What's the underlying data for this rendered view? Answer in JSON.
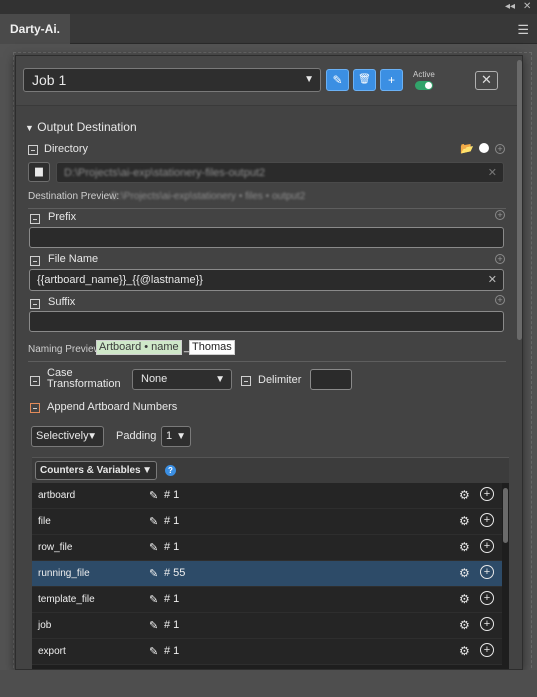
{
  "window": {
    "collapse_glyph": "◂◂",
    "close_glyph": "✕"
  },
  "tab": {
    "title": "Darty-Ai.",
    "menu_glyph": "☰"
  },
  "header": {
    "job_select": "Job 1",
    "active_label": "Active",
    "edit_glyph": "✎",
    "delete_glyph": "🗑",
    "add_glyph": "+",
    "close_glyph": "✕"
  },
  "output": {
    "section_label": "Output Destination",
    "directory_label": "Directory",
    "directory_path": "D:\\Projects\\ai-exp\\stationery-files-output2",
    "destination_preview_label": "Destination Preview:",
    "destination_preview_value": "D:\\Projects\\ai-exp\\stationery • files • output2",
    "prefix_label": "Prefix",
    "prefix_value": "",
    "filename_label": "File Name",
    "filename_value": "{{artboard_name}}_{{@lastname}}",
    "suffix_label": "Suffix",
    "suffix_value": "",
    "naming_preview_label": "Naming Preview:",
    "naming_preview_artboard": "Artboard • name",
    "naming_preview_sep": "_",
    "naming_preview_name": "Thomas",
    "case_label_line1": "Case",
    "case_label_line2": "Transformation",
    "case_value": "None",
    "delimiter_label": "Delimiter",
    "delimiter_value": "",
    "append_label": "Append Artboard Numbers",
    "selectively_value": "Selectively",
    "padding_label": "Padding",
    "padding_value": "1"
  },
  "counters": {
    "dropdown_label": "Counters & Variables",
    "help_glyph": "?",
    "rows": [
      {
        "name": "artboard",
        "value": "# 1"
      },
      {
        "name": "file",
        "value": "# 1"
      },
      {
        "name": "row_file",
        "value": "# 1"
      },
      {
        "name": "running_file",
        "value": "# 55"
      },
      {
        "name": "template_file",
        "value": "# 1"
      },
      {
        "name": "job",
        "value": "# 1"
      },
      {
        "name": "export",
        "value": "# 1"
      }
    ]
  },
  "colors": {
    "accent": "#3b8fe3",
    "active_toggle": "#31a36a",
    "selected_row": "#2d4b68",
    "naming_highlight": "#cfe8c9"
  }
}
